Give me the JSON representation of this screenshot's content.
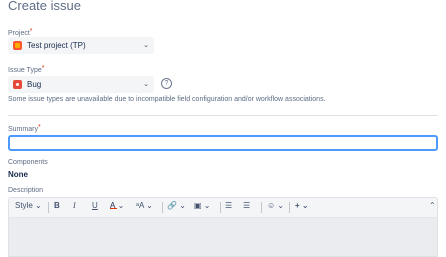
{
  "page": {
    "title": "Create issue"
  },
  "project": {
    "label": "Project",
    "required_mark": "*",
    "value": "Test project (TP)",
    "chevron": "⌄"
  },
  "issue_type": {
    "label": "Issue Type",
    "required_mark": "*",
    "value": "Bug",
    "chevron": "⌄",
    "help_glyph": "?",
    "note": "Some issue types are unavailable due to incompatible field configuration and/or workflow associations."
  },
  "summary": {
    "label": "Summary",
    "required_mark": "*",
    "value": ""
  },
  "components": {
    "label": "Components",
    "value": "None"
  },
  "description": {
    "label": "Description",
    "toolbar": {
      "style": "Style",
      "style_chevron": "⌄",
      "bold": "B",
      "italic": "I",
      "underline": "U",
      "text_color": "A",
      "text_color_chevron": "⌄",
      "more_format": "ᵃA",
      "more_format_chevron": "⌄",
      "link": "🔗",
      "link_chevron": "⌄",
      "attachment": "▣",
      "attachment_chevron": "⌄",
      "bullet_list": "☰",
      "numbered_list": "☰",
      "emoji": "☺",
      "emoji_chevron": "⌄",
      "insert": "+",
      "insert_chevron": "⌄",
      "collapse": "⌃"
    }
  },
  "colors": {
    "accent": "#4c9aff",
    "required": "#de350b",
    "project_icon": "#ff5630",
    "bug_icon": "#e5493a"
  },
  "icons": {
    "project": "project-avatar-icon",
    "bug": "bug-icon",
    "help": "help-icon"
  }
}
